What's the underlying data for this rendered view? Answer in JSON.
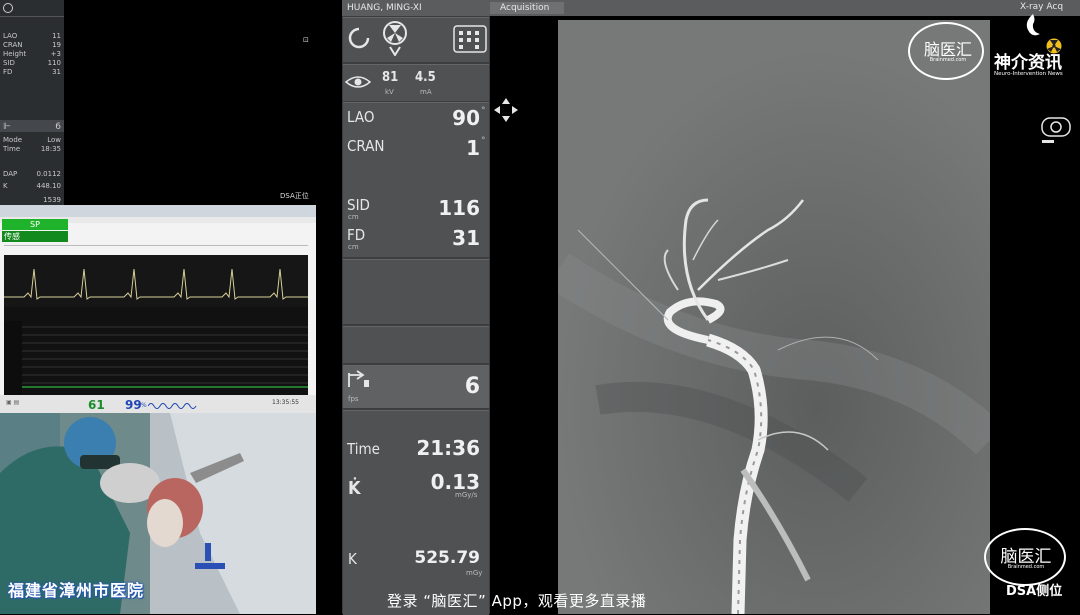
{
  "left_strip": {
    "rows": [
      {
        "label": "LAO",
        "value": "11"
      },
      {
        "label": "CRAN",
        "value": "19"
      },
      {
        "label": "Height",
        "value": "+3"
      },
      {
        "label": "SID",
        "value": "110"
      },
      {
        "label": "FD",
        "value": "31"
      }
    ],
    "fps_value": "6",
    "rows2": [
      {
        "label": "Mode",
        "value": "Low"
      },
      {
        "label": "Time",
        "value": "18:35"
      },
      {
        "label": "DAP",
        "value": "0.0112"
      },
      {
        "label": "K",
        "value": "448.10"
      }
    ],
    "bottom_value": "1539",
    "dsa_tag_top": "DSA正位"
  },
  "monitor": {
    "green_label_1": "SP",
    "green_label_2": "传感",
    "hr": "61",
    "spo2": "99",
    "spo2_unit": "%",
    "time": "13:35:55"
  },
  "camera": {
    "hospital_label": "福建省漳州市医院"
  },
  "panel": {
    "patient_name": "HUANG, MING-XI",
    "kv": "81",
    "kv_unit": "kV",
    "ma": "4.5",
    "ma_unit": "mA",
    "angles": [
      {
        "label": "LAO",
        "value": "90"
      },
      {
        "label": "CRAN",
        "value": "1"
      }
    ],
    "sid_label": "SID",
    "sid_unit": "cm",
    "sid_value": "116",
    "fd_label": "FD",
    "fd_unit": "cm",
    "fd_value": "31",
    "fps_value": "6",
    "fps_unit": "fps",
    "time_label": "Time",
    "time_value": "21:36",
    "kdot_label": "K̇",
    "kdot_value": "0.13",
    "kdot_unit": "mGy/s",
    "k_label": "K",
    "k_value": "525.79",
    "k_unit": "mGy"
  },
  "viewer": {
    "tab": "Acquisition",
    "mode_label": "X-ray Acq"
  },
  "brand": {
    "logo_text": "脑医汇",
    "logo_sub": "Brainmed.com",
    "news_title": "神介资讯",
    "news_sub": "Neuro-Intervention News",
    "dsa_side": "DSA侧位"
  },
  "subtitle": "登录 “脑医汇” App，观看更多直录播",
  "colors": {
    "panel_bg": "#3b3d3f",
    "box_bg": "#4f5153",
    "hr_green": "#1c8c2a",
    "spo2_blue": "#1f46b5",
    "alarm_green": "#1fb22b"
  }
}
